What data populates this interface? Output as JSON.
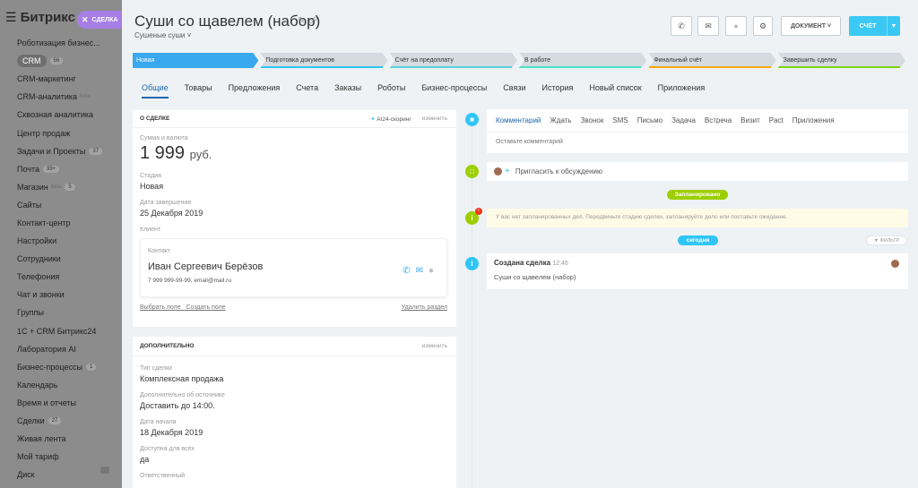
{
  "sidebar": {
    "logo": "Битрикс",
    "tab_label": "СДЕЛКА",
    "items": [
      {
        "label": "Роботизация бизнес...",
        "badge": "",
        "sup": ""
      },
      {
        "label": "CRM",
        "badge": "56",
        "sup": "",
        "active": true
      },
      {
        "label": "CRM-маркетинг",
        "badge": "",
        "sup": ""
      },
      {
        "label": "CRM-аналитика",
        "badge": "",
        "sup": "beta"
      },
      {
        "label": "Сквозная аналитика",
        "badge": "",
        "sup": ""
      },
      {
        "label": "Центр продаж",
        "badge": "",
        "sup": ""
      },
      {
        "label": "Задачи и Проекты",
        "badge": "37",
        "sup": ""
      },
      {
        "label": "Почта",
        "badge": "99+",
        "sup": ""
      },
      {
        "label": "Магазин",
        "badge": "5",
        "sup": "beta"
      },
      {
        "label": "Сайты",
        "badge": "",
        "sup": ""
      },
      {
        "label": "Контакт-центр",
        "badge": "",
        "sup": ""
      },
      {
        "label": "Настройки",
        "badge": "",
        "sup": ""
      },
      {
        "label": "Сотрудники",
        "badge": "",
        "sup": ""
      },
      {
        "label": "Телефония",
        "badge": "",
        "sup": ""
      },
      {
        "label": "Чат и звонки",
        "badge": "",
        "sup": ""
      },
      {
        "label": "Группы",
        "badge": "",
        "sup": ""
      },
      {
        "label": "1С + CRM Битрикс24",
        "badge": "",
        "sup": ""
      },
      {
        "label": "Лаборатория AI",
        "badge": "",
        "sup": ""
      },
      {
        "label": "Бизнес-процессы",
        "badge": "1",
        "sup": ""
      },
      {
        "label": "Календарь",
        "badge": "",
        "sup": ""
      },
      {
        "label": "Время и отчеты",
        "badge": "",
        "sup": ""
      },
      {
        "label": "Сделки",
        "badge": "27",
        "sup": ""
      },
      {
        "label": "Живая лента",
        "badge": "",
        "sup": ""
      },
      {
        "label": "Мой тариф",
        "badge": "",
        "sup": ""
      },
      {
        "label": "Диск",
        "badge": "",
        "sup": ""
      }
    ]
  },
  "header": {
    "title": "Суши со щавелем (набор)",
    "subtitle": "Сушеные суши",
    "document_label": "ДОКУМЕНТ",
    "account_label": "СЧЁТ"
  },
  "stages": [
    {
      "label": "Новая",
      "color": "#39a8ef",
      "current": true
    },
    {
      "label": "Подготовка документов",
      "color": "#2fc6f6"
    },
    {
      "label": "Счёт на предоплату",
      "color": "#55d0e0"
    },
    {
      "label": "В работе",
      "color": "#47e4c2"
    },
    {
      "label": "Финальный счёт",
      "color": "#ffa900"
    },
    {
      "label": "Завершить сделку",
      "color": "#7bd500"
    }
  ],
  "tabs": [
    "Общие",
    "Товары",
    "Предложения",
    "Счета",
    "Заказы",
    "Роботы",
    "Бизнес-процессы",
    "Связи",
    "История",
    "Новый список",
    "Приложения"
  ],
  "deal_card": {
    "title": "О СДЕЛКЕ",
    "ai_label": "AI24-скоринг",
    "edit_label": "изменить",
    "sum_label": "Сумма и валюта",
    "sum_value": "1 999",
    "currency": "руб.",
    "stage_label": "Стадия",
    "stage_value": "Новая",
    "close_label": "Дата завершения",
    "close_value": "25 Декабря 2019",
    "client_label": "Клиент",
    "contact_label": "Контакт",
    "contact_name": "Иван Сергеевич Берёзов",
    "contact_info": "7 999 999-99-99, email@mail.ru",
    "select_field": "Выбрать поле",
    "create_field": "Создать поле",
    "delete_section": "Удалить раздел"
  },
  "extra_card": {
    "title": "ДОПОЛНИТЕЛЬНО",
    "edit_label": "изменить",
    "fields": [
      {
        "label": "Тип сделки",
        "value": "Комплексная продажа"
      },
      {
        "label": "Дополнительно об источнике",
        "value": "Доставить до 14:00."
      },
      {
        "label": "Дата начала",
        "value": "18 Декабря 2019"
      },
      {
        "label": "Доступна для всех",
        "value": "да"
      },
      {
        "label": "Ответственный",
        "value": ""
      }
    ]
  },
  "timeline": {
    "tabs": [
      "Комментарий",
      "Ждать",
      "Звонок",
      "SMS",
      "Письмо",
      "Задача",
      "Встреча",
      "Визит",
      "Pact",
      "Приложения"
    ],
    "comment_placeholder": "Оставьте комментарий",
    "invite_label": "Пригласить к обсуждению",
    "planned_label": "Запланировано",
    "planned_note": "У вас нет запланированных дел. Передвиньте стадию сделки, запланируйте дело или поставьте ожидание.",
    "today_label": "сегодня",
    "filter_label": "ФИЛЬТР",
    "created_title": "Создана сделка",
    "created_time": "12:46",
    "created_text": "Суши со щавелем (набор)"
  }
}
